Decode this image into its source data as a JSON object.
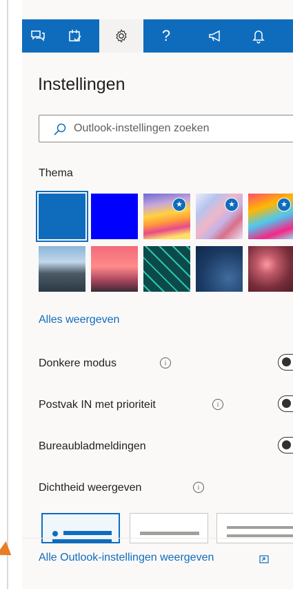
{
  "topbar": {
    "icons": [
      "chat-icon",
      "task-icon",
      "settings-gear-icon",
      "help-icon",
      "feedback-icon",
      "notification-bell-icon"
    ],
    "active": "settings-gear-icon",
    "color": "#0f6cbd"
  },
  "settings": {
    "title": "Instellingen",
    "search_placeholder": "Outlook-instellingen zoeken"
  },
  "theme": {
    "label": "Thema",
    "swatches": [
      {
        "name": "theme-blue",
        "selected": true
      },
      {
        "name": "theme-bright-blue",
        "premium": false
      },
      {
        "name": "theme-rainbow-waves",
        "premium": true
      },
      {
        "name": "theme-pastel-ribbons",
        "premium": true
      },
      {
        "name": "theme-colorful-art",
        "premium": true
      },
      {
        "name": "theme-mountain-sky"
      },
      {
        "name": "theme-sunset-palms"
      },
      {
        "name": "theme-circuit"
      },
      {
        "name": "theme-elevation-blueprint"
      },
      {
        "name": "theme-bokeh-lights"
      }
    ],
    "show_all": "Alles weergeven"
  },
  "toggles": [
    {
      "label": "Donkere modus",
      "info": true,
      "on": false
    },
    {
      "label": "Postvak IN met prioriteit",
      "info": true,
      "on": false
    },
    {
      "label": "Bureaubladmeldingen",
      "info": false,
      "on": false
    }
  ],
  "density": {
    "label": "Dichtheid weergeven",
    "options": [
      "full",
      "medium",
      "compact"
    ],
    "selected": "full"
  },
  "footer": {
    "all_settings_link": "Alle Outlook-instellingen weergeven"
  },
  "colors": {
    "accent": "#0f6cbd",
    "panel_bg": "#faf9f8",
    "highlight_arrow": "#e67e22"
  }
}
